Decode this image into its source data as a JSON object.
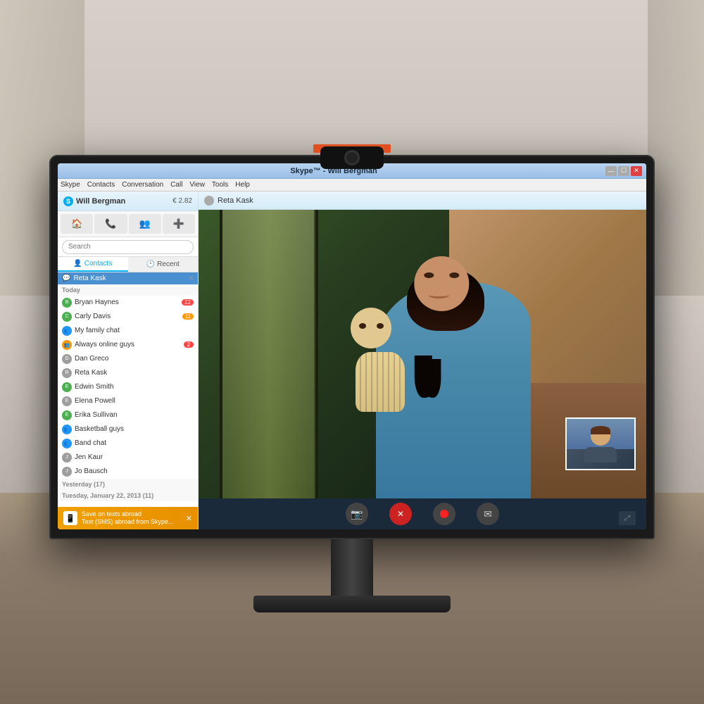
{
  "window": {
    "title": "Skype™ - Will Bergman",
    "min_label": "—",
    "max_label": "☐",
    "close_label": "✕"
  },
  "menu": {
    "items": [
      "Skype",
      "Contacts",
      "Conversation",
      "Call",
      "View",
      "Tools",
      "Help"
    ]
  },
  "user": {
    "name": "Will Bergman",
    "credit": "€ 2.82"
  },
  "call_contact": {
    "name": "Reta Kask"
  },
  "search": {
    "placeholder": "Search"
  },
  "tabs": {
    "contacts_label": "Contacts",
    "recent_label": "Recent"
  },
  "active_contact": {
    "name": "Reta Kask"
  },
  "sections": {
    "today": "Today",
    "yesterday": "Yesterday (17)",
    "tuesday": "Tuesday, January 22, 2013 (11)"
  },
  "contacts": [
    {
      "name": "Bryan Haynes",
      "status": "green",
      "badge": "22"
    },
    {
      "name": "Carly Davis",
      "status": "green",
      "badge": "11"
    },
    {
      "name": "My family chat",
      "status": "group",
      "badge": ""
    },
    {
      "name": "Always online guys",
      "status": "group",
      "badge": "2"
    },
    {
      "name": "Dan Greco",
      "status": "gray",
      "badge": ""
    },
    {
      "name": "Reta Kask",
      "status": "gray",
      "badge": ""
    },
    {
      "name": "Edwin Smith",
      "status": "green",
      "badge": ""
    },
    {
      "name": "Elena Powell",
      "status": "gray",
      "badge": ""
    },
    {
      "name": "Erika Sullivan",
      "status": "green",
      "badge": ""
    },
    {
      "name": "Basketball guys",
      "status": "group",
      "badge": ""
    },
    {
      "name": "Band chat",
      "status": "group",
      "badge": ""
    },
    {
      "name": "Jen Kaur",
      "status": "gray",
      "badge": ""
    },
    {
      "name": "Jo Bausch",
      "status": "gray",
      "badge": ""
    }
  ],
  "banner": {
    "title": "Save on texts abroad",
    "subtitle": "Text (SMS) abroad from Skype..."
  },
  "controls": {
    "camera_icon": "📷",
    "end_call_icon": "✕",
    "record_label": "●",
    "message_icon": "✉",
    "expand_icon": "⤢"
  }
}
